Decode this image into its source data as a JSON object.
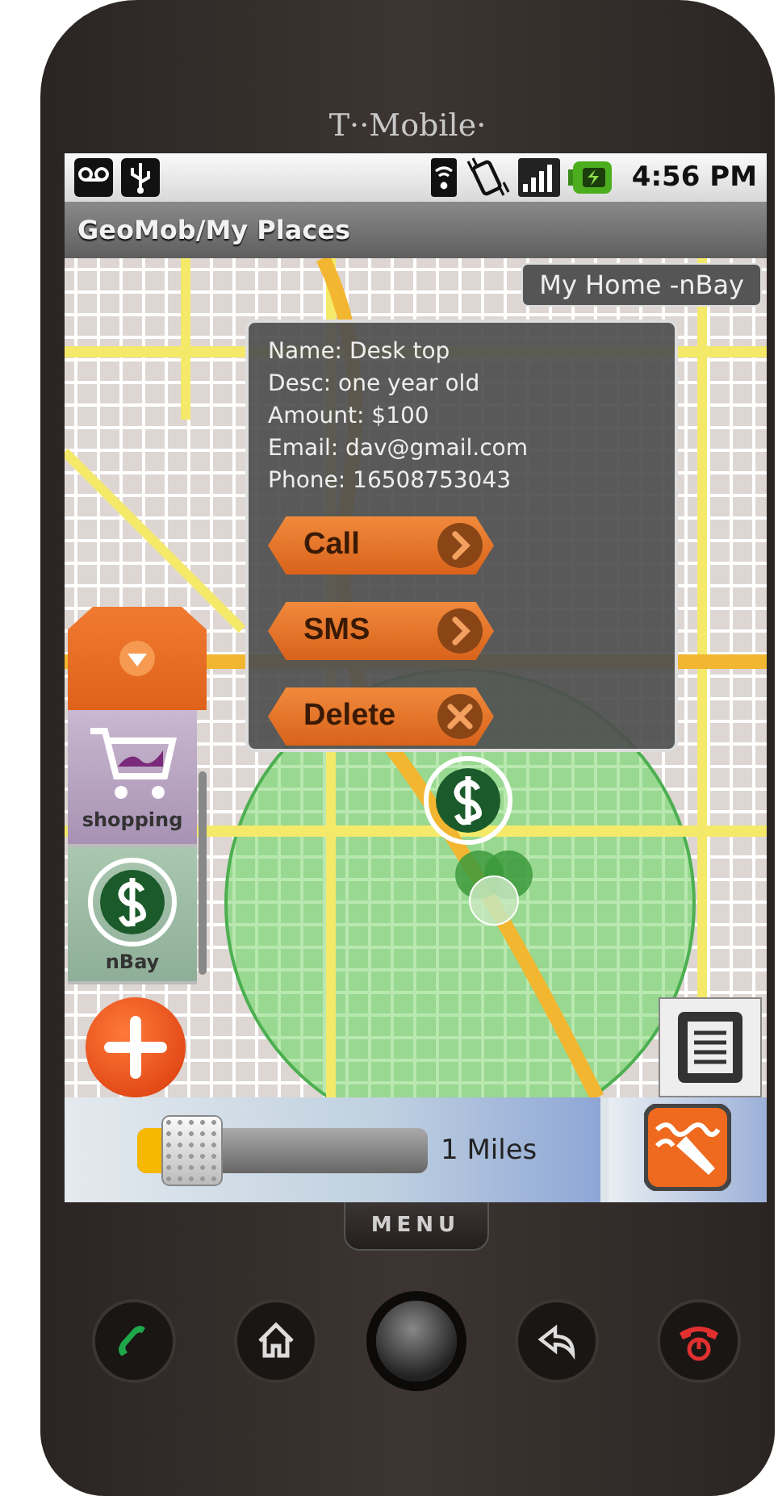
{
  "device": {
    "carrier": "T··Mobile·"
  },
  "status_bar": {
    "time": "4:56 PM"
  },
  "app_bar": {
    "title": "GeoMob/My Places"
  },
  "map": {
    "location_label": "My Home -nBay"
  },
  "popup": {
    "lines": [
      "Name: Desk top",
      "Desc: one year old",
      "Amount: $100",
      "Email: dav@gmail.com",
      "Phone: 16508753043"
    ],
    "actions": [
      {
        "label": "Call",
        "kind": "go"
      },
      {
        "label": "SMS",
        "kind": "go"
      },
      {
        "label": "Delete",
        "kind": "remove"
      }
    ]
  },
  "categories": [
    {
      "label": "shopping",
      "kind": "cart"
    },
    {
      "label": "nBay",
      "kind": "dollar"
    }
  ],
  "radius": {
    "level": 0.05,
    "reading": "1 Miles"
  },
  "hard_keys": {
    "menu_label": "MENU"
  }
}
